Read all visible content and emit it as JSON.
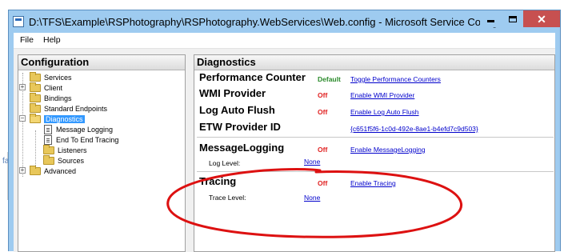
{
  "window": {
    "title": "D:\\TFS\\Example\\RSPhotography\\RSPhotography.WebServices\\Web.config - Microsoft Service Configurati..."
  },
  "menu": [
    "File",
    "Help"
  ],
  "configuration": {
    "header": "Configuration",
    "tree": [
      {
        "label": "Services"
      },
      {
        "label": "Client"
      },
      {
        "label": "Bindings"
      },
      {
        "label": "Standard Endpoints"
      },
      {
        "label": "Diagnostics"
      },
      {
        "label": "Message Logging"
      },
      {
        "label": "End To End Tracing"
      },
      {
        "label": "Listeners"
      },
      {
        "label": "Sources"
      },
      {
        "label": "Advanced"
      }
    ]
  },
  "diagnostics": {
    "header": "Diagnostics",
    "performance_counter": {
      "name": "Performance Counter",
      "status": "Default",
      "action": "Toggle Performance Counters"
    },
    "wmi_provider": {
      "name": "WMI Provider",
      "status": "Off",
      "action": "Enable WMI Provider"
    },
    "log_auto_flush": {
      "name": "Log Auto Flush",
      "status": "Off",
      "action": "Enable Log Auto Flush"
    },
    "etw_provider": {
      "name": "ETW Provider ID",
      "value": "{c651f5f6-1c0d-492e-8ae1-b4efd7c9d503}"
    },
    "message_logging": {
      "name": "MessageLogging",
      "status": "Off",
      "action": "Enable MessageLogging",
      "level_label": "Log Level:",
      "level_value": "None"
    },
    "tracing": {
      "name": "Tracing",
      "status": "Off",
      "action": "Enable Tracing",
      "level_label": "Trace Level:",
      "level_value": "None"
    }
  },
  "background": {
    "fragment": "fa"
  },
  "colors": {
    "status_off": "#e02020",
    "status_default": "#2a8a2a",
    "link": "#0000cc",
    "annotation": "#dd1111",
    "selection": "#3399ff"
  }
}
